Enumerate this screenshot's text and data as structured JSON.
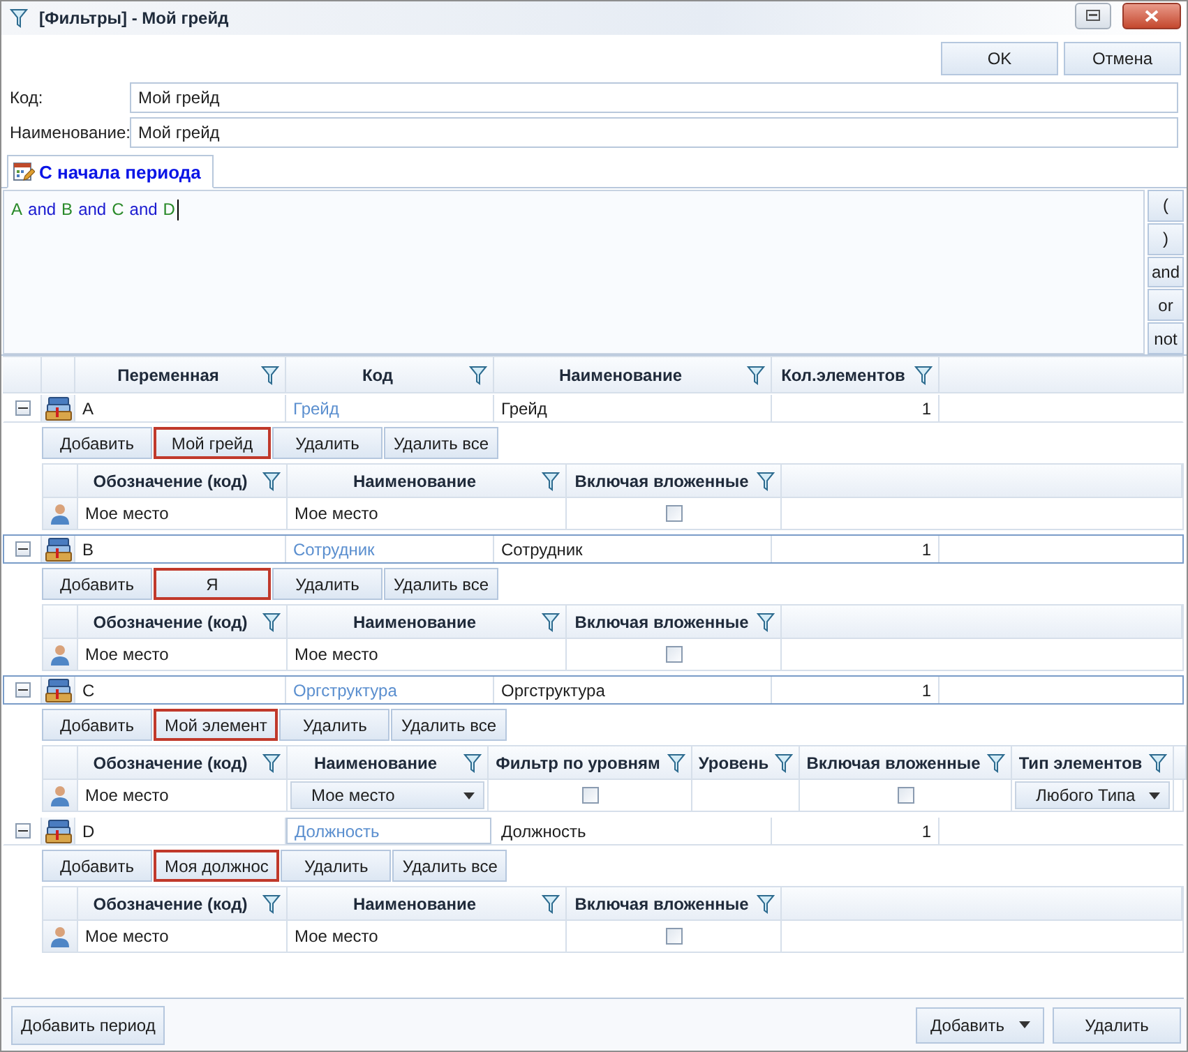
{
  "window": {
    "title": "[Фильтры] - Мой грейд"
  },
  "toolbar": {
    "buttons": [
      "OK",
      "Отмена"
    ]
  },
  "fields": [
    {
      "label": "Код:",
      "value": "Мой грейд"
    },
    {
      "label": "Наименование:",
      "value": "Мой грейд"
    }
  ],
  "tabs": [
    {
      "label": "С начала периода",
      "selected": true
    }
  ],
  "expression": {
    "tokens": [
      {
        "text": "A",
        "kind": "variable"
      },
      {
        "text": "and",
        "kind": "operator"
      },
      {
        "text": "B",
        "kind": "variable"
      },
      {
        "text": "and",
        "kind": "operator"
      },
      {
        "text": "C",
        "kind": "variable"
      },
      {
        "text": "and",
        "kind": "operator"
      },
      {
        "text": "D",
        "kind": "variable"
      }
    ],
    "operator_buttons": [
      "(",
      ")",
      "and",
      "or",
      "not"
    ]
  },
  "grid": {
    "columns": [
      {
        "label": "Переменная"
      },
      {
        "label": "Код"
      },
      {
        "label": "Наименование"
      },
      {
        "label": "Кол.элементов"
      }
    ],
    "rows": [
      {
        "variable": "A",
        "code": "Грейд",
        "name": "Грейд",
        "count": "1",
        "expanded": true,
        "selected": false,
        "code_editing": false,
        "actions": [
          {
            "label": "Добавить",
            "highlighted": false
          },
          {
            "label": "Мой грейд",
            "highlighted": true
          },
          {
            "label": "Удалить",
            "highlighted": false
          },
          {
            "label": "Удалить все",
            "highlighted": false
          }
        ],
        "detail": {
          "columns": [
            "Обозначение (код)",
            "Наименование",
            "Включая вложенные"
          ],
          "rows": [
            {
              "cells": [
                {
                  "kind": "text",
                  "value": "Мое место"
                },
                {
                  "kind": "text",
                  "value": "Мое место"
                },
                {
                  "kind": "checkbox",
                  "checked": false
                }
              ]
            }
          ]
        }
      },
      {
        "variable": "B",
        "code": "Сотрудник",
        "name": "Сотрудник",
        "count": "1",
        "expanded": true,
        "selected": true,
        "code_editing": false,
        "actions": [
          {
            "label": "Добавить",
            "highlighted": false
          },
          {
            "label": "Я",
            "highlighted": true
          },
          {
            "label": "Удалить",
            "highlighted": false
          },
          {
            "label": "Удалить все",
            "highlighted": false
          }
        ],
        "detail": {
          "columns": [
            "Обозначение (код)",
            "Наименование",
            "Включая вложенные"
          ],
          "rows": [
            {
              "cells": [
                {
                  "kind": "text",
                  "value": "Мое место"
                },
                {
                  "kind": "text",
                  "value": "Мое место"
                },
                {
                  "kind": "checkbox",
                  "checked": false
                }
              ]
            }
          ]
        }
      },
      {
        "variable": "C",
        "code": "Оргструктура",
        "name": "Оргструктура",
        "count": "1",
        "expanded": true,
        "selected": true,
        "code_editing": false,
        "actions": [
          {
            "label": "Добавить",
            "highlighted": false
          },
          {
            "label": "Мой элемент",
            "highlighted": true
          },
          {
            "label": "Удалить",
            "highlighted": false
          },
          {
            "label": "Удалить все",
            "highlighted": false
          }
        ],
        "detail": {
          "columns": [
            "Обозначение (код)",
            "Наименование",
            "Фильтр по уровням",
            "Уровень",
            "Включая вложенные",
            "Тип элементов"
          ],
          "rows": [
            {
              "cells": [
                {
                  "kind": "text",
                  "value": "Мое место"
                },
                {
                  "kind": "dropdown",
                  "value": "Мое место"
                },
                {
                  "kind": "checkbox",
                  "checked": false
                },
                {
                  "kind": "empty"
                },
                {
                  "kind": "checkbox",
                  "checked": false
                },
                {
                  "kind": "dropdown",
                  "value": "Любого Типа"
                }
              ]
            }
          ]
        }
      },
      {
        "variable": "D",
        "code": "Должность",
        "name": "Должность",
        "count": "1",
        "expanded": true,
        "selected": false,
        "code_editing": true,
        "actions": [
          {
            "label": "Добавить",
            "highlighted": false
          },
          {
            "label": "Моя должнос",
            "highlighted": true
          },
          {
            "label": "Удалить",
            "highlighted": false
          },
          {
            "label": "Удалить все",
            "highlighted": false
          }
        ],
        "detail": {
          "columns": [
            "Обозначение (код)",
            "Наименование",
            "Включая вложенные"
          ],
          "rows": [
            {
              "cells": [
                {
                  "kind": "text",
                  "value": "Мое место"
                },
                {
                  "kind": "text",
                  "value": "Мое место"
                },
                {
                  "kind": "checkbox",
                  "checked": false
                }
              ]
            }
          ]
        }
      }
    ]
  },
  "footer": {
    "left_buttons": [
      "Добавить период"
    ],
    "right_buttons": [
      {
        "label": "Добавить",
        "kind": "split"
      },
      {
        "label": "Удалить",
        "kind": "plain"
      }
    ]
  }
}
